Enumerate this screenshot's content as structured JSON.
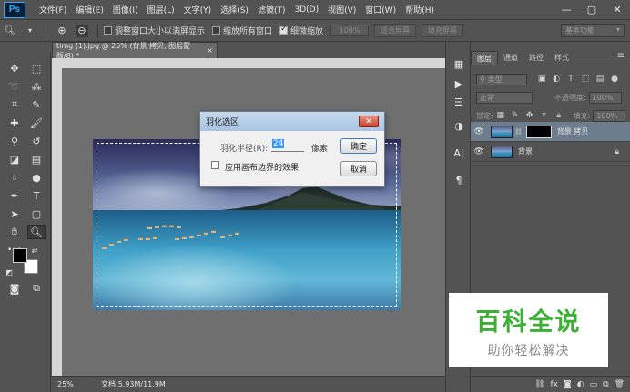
{
  "app": {
    "logo": "Ps",
    "menu": [
      "文件(F)",
      "编辑(E)",
      "图像(I)",
      "图层(L)",
      "文字(Y)",
      "选择(S)",
      "滤镜(T)",
      "3D(D)",
      "视图(V)",
      "窗口(W)",
      "帮助(H)"
    ],
    "window_controls": {
      "minimize": "—",
      "restore": "▢",
      "close": "✕"
    }
  },
  "options": {
    "tool_icon": "zoom-icon",
    "resize_windows": "调整窗口大小以满屏显示",
    "zoom_all": "缩放所有窗口",
    "scrubby_zoom": "细微缩放",
    "zoom_value": "100%",
    "fit_screen": "适合屏幕",
    "fill_screen": "填充屏幕",
    "workspace": "基本功能"
  },
  "document": {
    "tab_title": "timg (1).jpg @ 25% (背景 拷贝, 图层蒙版/8) *",
    "tab_close": "×",
    "zoom": "25%",
    "doc_size": "文档:5.93M/11.9M"
  },
  "dialog": {
    "title": "羽化选区",
    "close": "✕",
    "radius_label": "羽化半径(R):",
    "radius_value": "24",
    "radius_unit": "像素",
    "canvas_bounds_label": "应用画布边界的效果",
    "ok": "确定",
    "cancel": "取消"
  },
  "panels": {
    "tabs": [
      "图层",
      "通道",
      "路径",
      "样式"
    ],
    "menu_icon": "≡",
    "filter_kind": "类型",
    "blend_mode": "正常",
    "opacity_label": "不透明度:",
    "opacity_value": "100%",
    "lock_label": "锁定:",
    "fill_label": "填充:",
    "fill_value": "100%",
    "layers": [
      {
        "name": "背景 拷贝",
        "has_mask": true,
        "selected": true
      },
      {
        "name": "背景",
        "has_mask": false,
        "selected": false
      }
    ],
    "footer_icons": [
      "link-icon",
      "fx-icon",
      "mask-icon",
      "adjustment-icon",
      "folder-icon",
      "new-layer-icon",
      "trash-icon"
    ]
  },
  "watermark": {
    "title": "百科全说",
    "subtitle": "助你轻松解决"
  }
}
